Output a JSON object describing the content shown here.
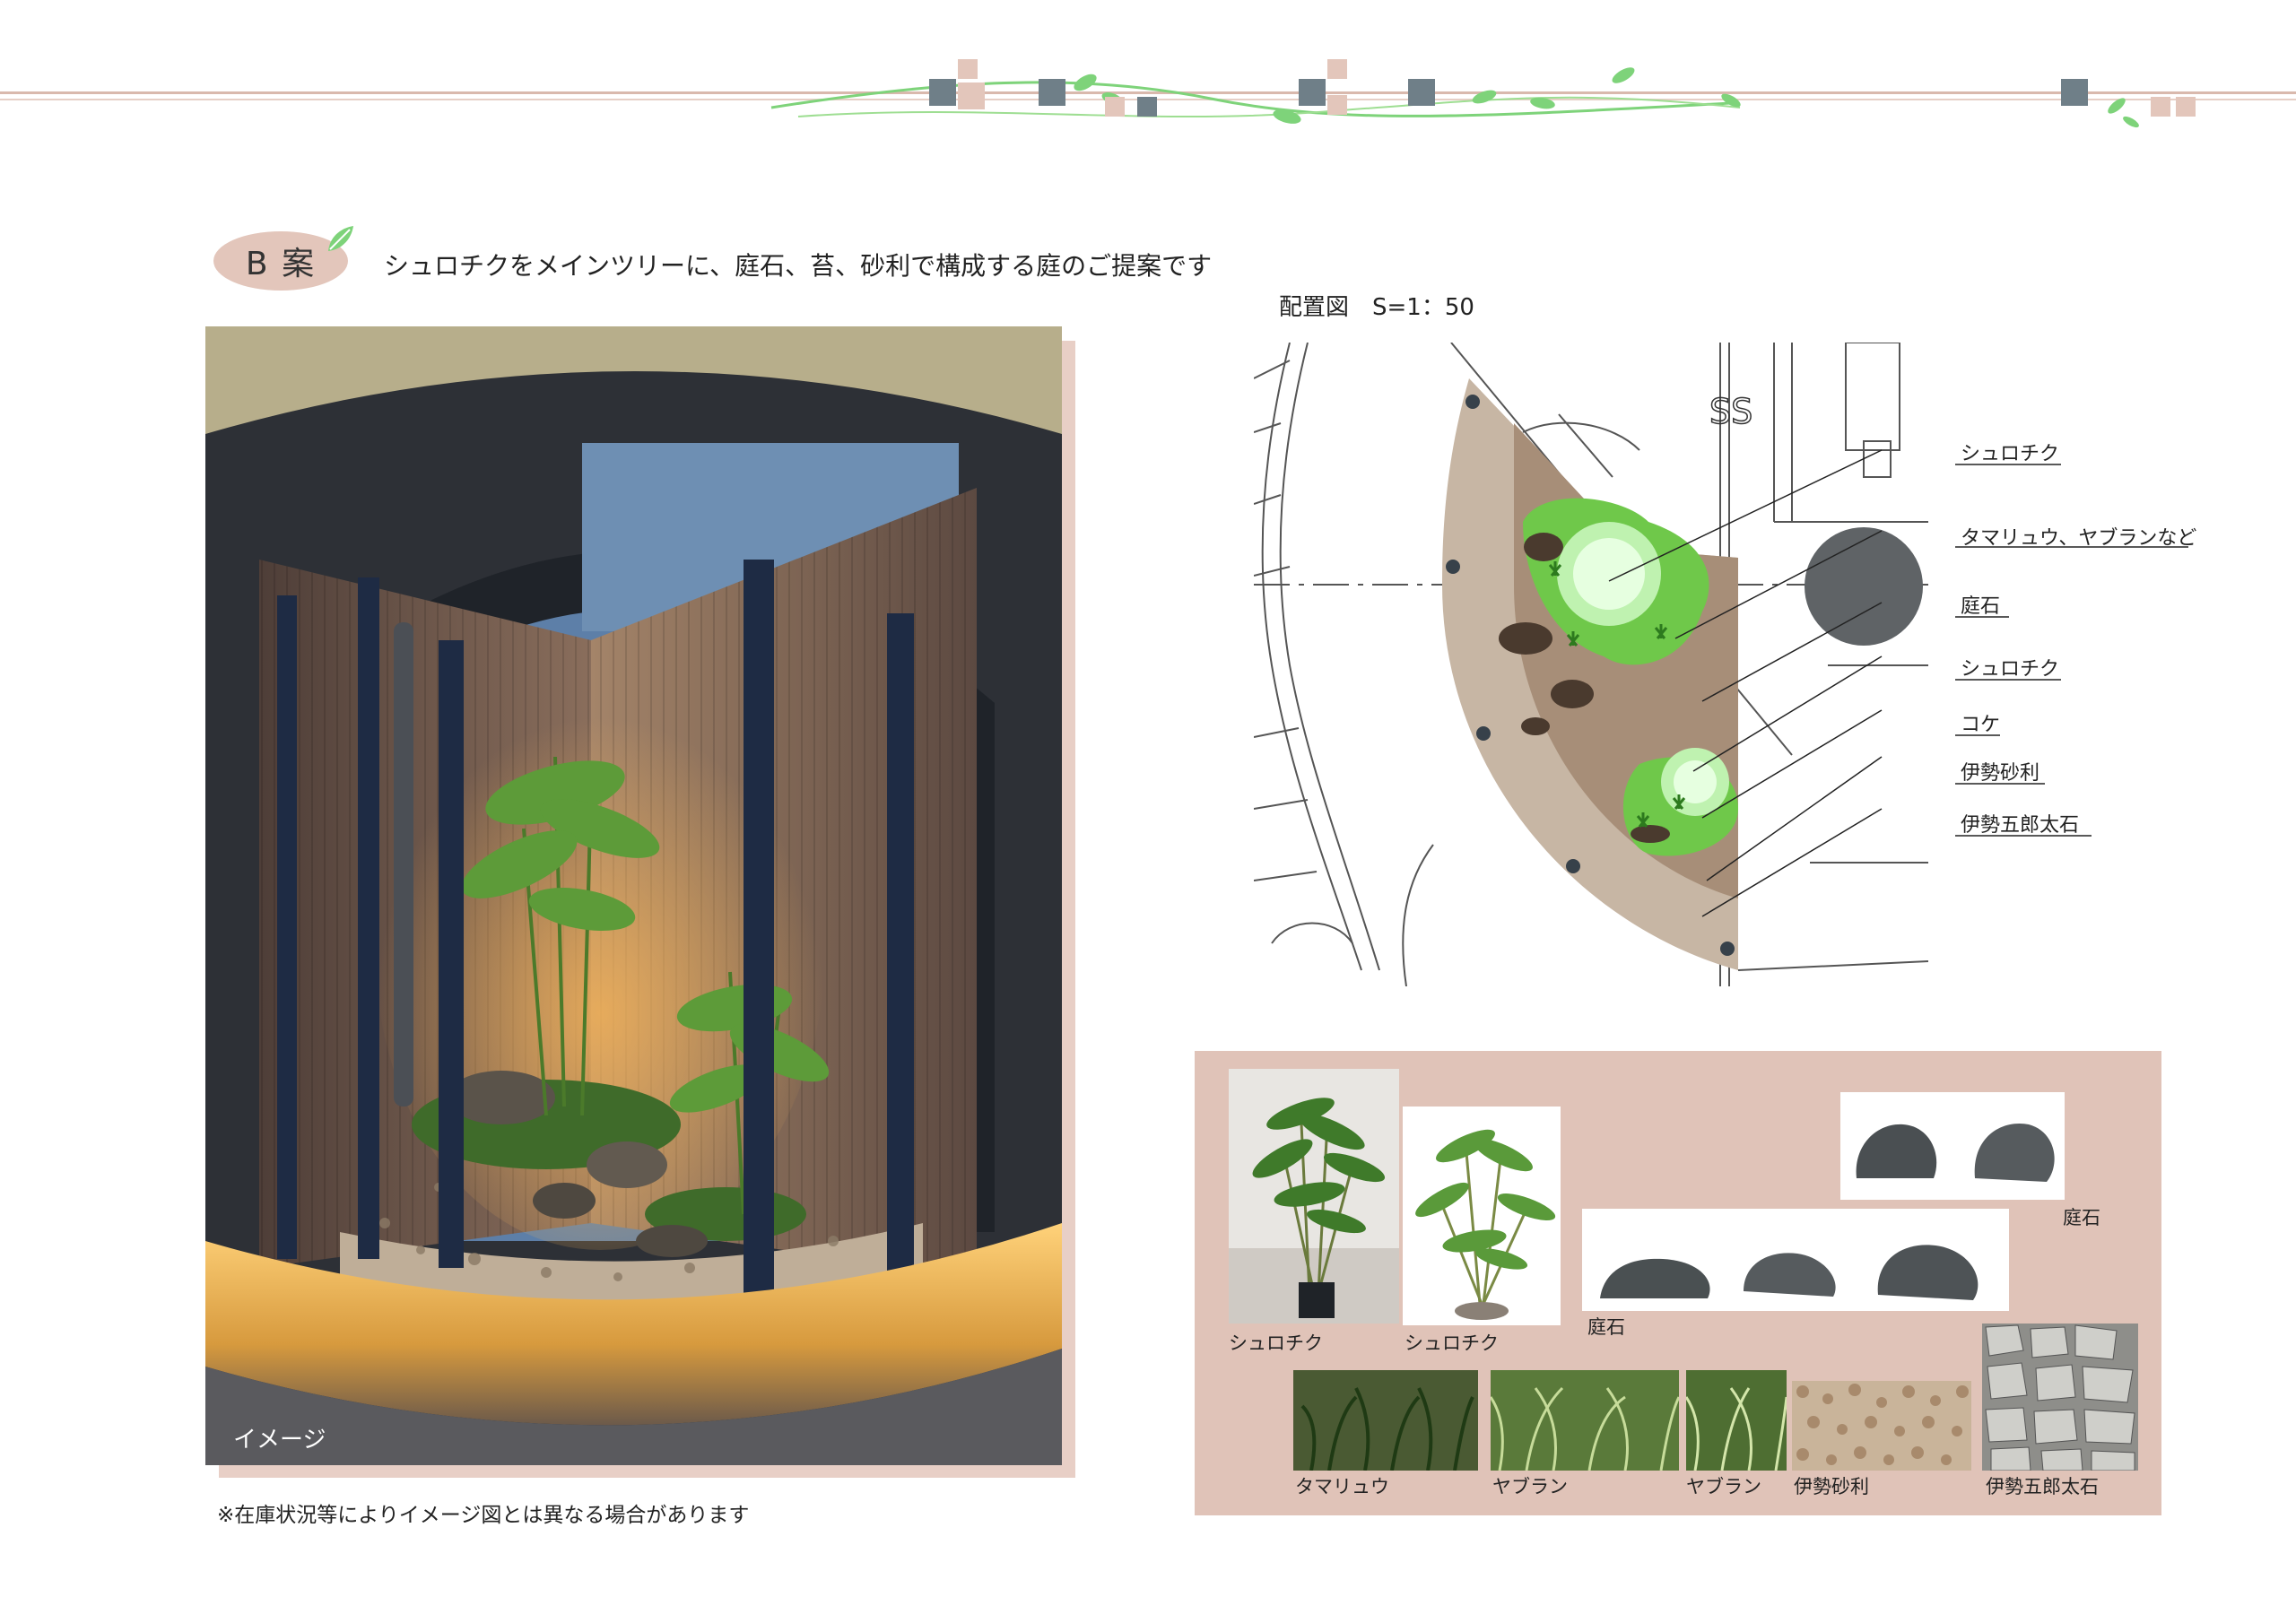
{
  "header": {
    "plan_label": "B 案",
    "headline": "シュロチクをメインツリーに、庭石、苔、砂利で構成する庭のご提案です"
  },
  "image": {
    "label": "イメージ",
    "note": "※在庫状況等によりイメージ図とは異なる場合があります"
  },
  "plan": {
    "title": "配置図　S=1：50",
    "drawing_text": "SS",
    "callouts": [
      "シュロチク",
      "タマリュウ、ヤブランなど",
      "庭石",
      "シュロチク",
      "コケ",
      "伊勢砂利",
      "伊勢五郎太石"
    ]
  },
  "materials": {
    "items": [
      "シュロチク",
      "シュロチク",
      "庭石",
      "庭石",
      "タマリュウ",
      "ヤブラン",
      "ヤブラン",
      "伊勢砂利",
      "伊勢五郎太石"
    ]
  },
  "colors": {
    "accent_pink": "#e3c6bb",
    "accent_grey": "#6f7f88",
    "leaf_green": "#7ed37a",
    "plan_soil": "#a78e78",
    "plan_border": "#c7b6a4",
    "moss_green": "#6fc84a"
  }
}
